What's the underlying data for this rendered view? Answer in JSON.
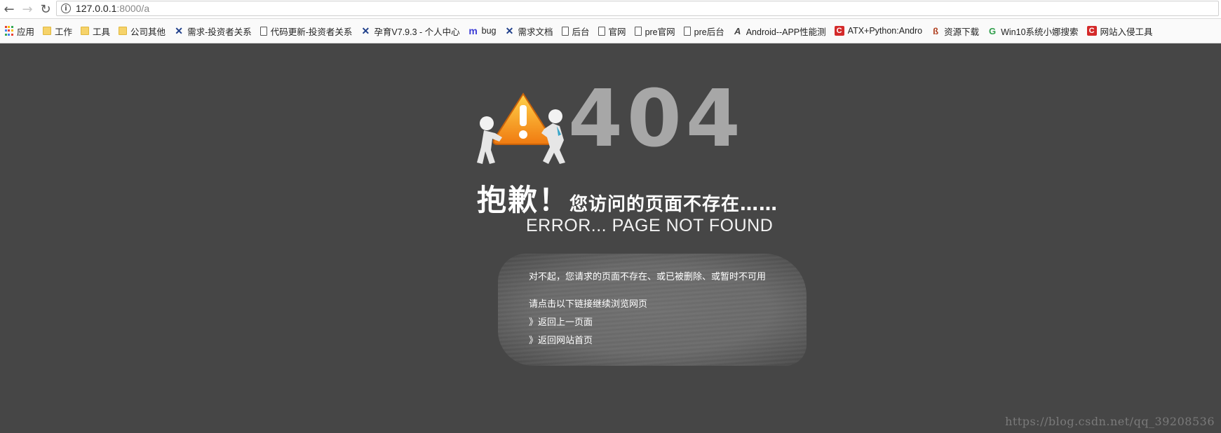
{
  "browser": {
    "back_icon": "←",
    "forward_icon": "→",
    "reload_icon": "↻",
    "info_icon": "i",
    "url_host": "127.0.0.1",
    "url_path": ":8000/a"
  },
  "bookmarks": [
    {
      "icon": "apps-icon",
      "label": "应用"
    },
    {
      "icon": "folder-icon",
      "label": "工作"
    },
    {
      "icon": "folder-icon",
      "label": "工具"
    },
    {
      "icon": "folder-icon",
      "label": "公司其他"
    },
    {
      "icon": "x-logo-icon",
      "glyph": "✕",
      "label": "需求-投资者关系"
    },
    {
      "icon": "page-icon",
      "label": "代码更新-投资者关系"
    },
    {
      "icon": "x-logo-icon",
      "glyph": "✕",
      "label": "孕育V7.9.3 - 个人中心"
    },
    {
      "icon": "m-logo-icon",
      "glyph": "m",
      "label": "bug"
    },
    {
      "icon": "x-logo-icon",
      "glyph": "✕",
      "label": "需求文档"
    },
    {
      "icon": "page-icon",
      "label": "后台"
    },
    {
      "icon": "page-icon",
      "label": "官网"
    },
    {
      "icon": "page-icon",
      "label": "pre官网"
    },
    {
      "icon": "page-icon",
      "label": "pre后台"
    },
    {
      "icon": "a-logo-icon",
      "glyph": "A",
      "label": "Android--APP性能测"
    },
    {
      "icon": "c-logo-icon",
      "glyph": "C",
      "label": "ATX+Python:Andro"
    },
    {
      "icon": "b-logo-icon",
      "glyph": "ß",
      "label": "资源下载"
    },
    {
      "icon": "g-logo-icon",
      "glyph": "G",
      "label": "Win10系统小娜搜索"
    },
    {
      "icon": "c-logo-icon",
      "glyph": "C",
      "label": "网站入侵工具"
    }
  ],
  "error_page": {
    "code": "404",
    "sorry_big": "抱歉！",
    "sorry_small": "您访问的页面不存在……",
    "error_en": "ERROR... PAGE NOT FOUND",
    "message_line1": "对不起，您请求的页面不存在、或已被删除、或暂时不可用",
    "message_line2": "请点击以下链接继续浏览网页",
    "link_back": "》返回上一页面",
    "link_home": "》返回网站首页"
  },
  "watermark": "https://blog.csdn.net/qq_39208536",
  "colors": {
    "page_background": "#464646",
    "code_color": "#a7a7a7",
    "warning_orange": "#f7a01b"
  }
}
